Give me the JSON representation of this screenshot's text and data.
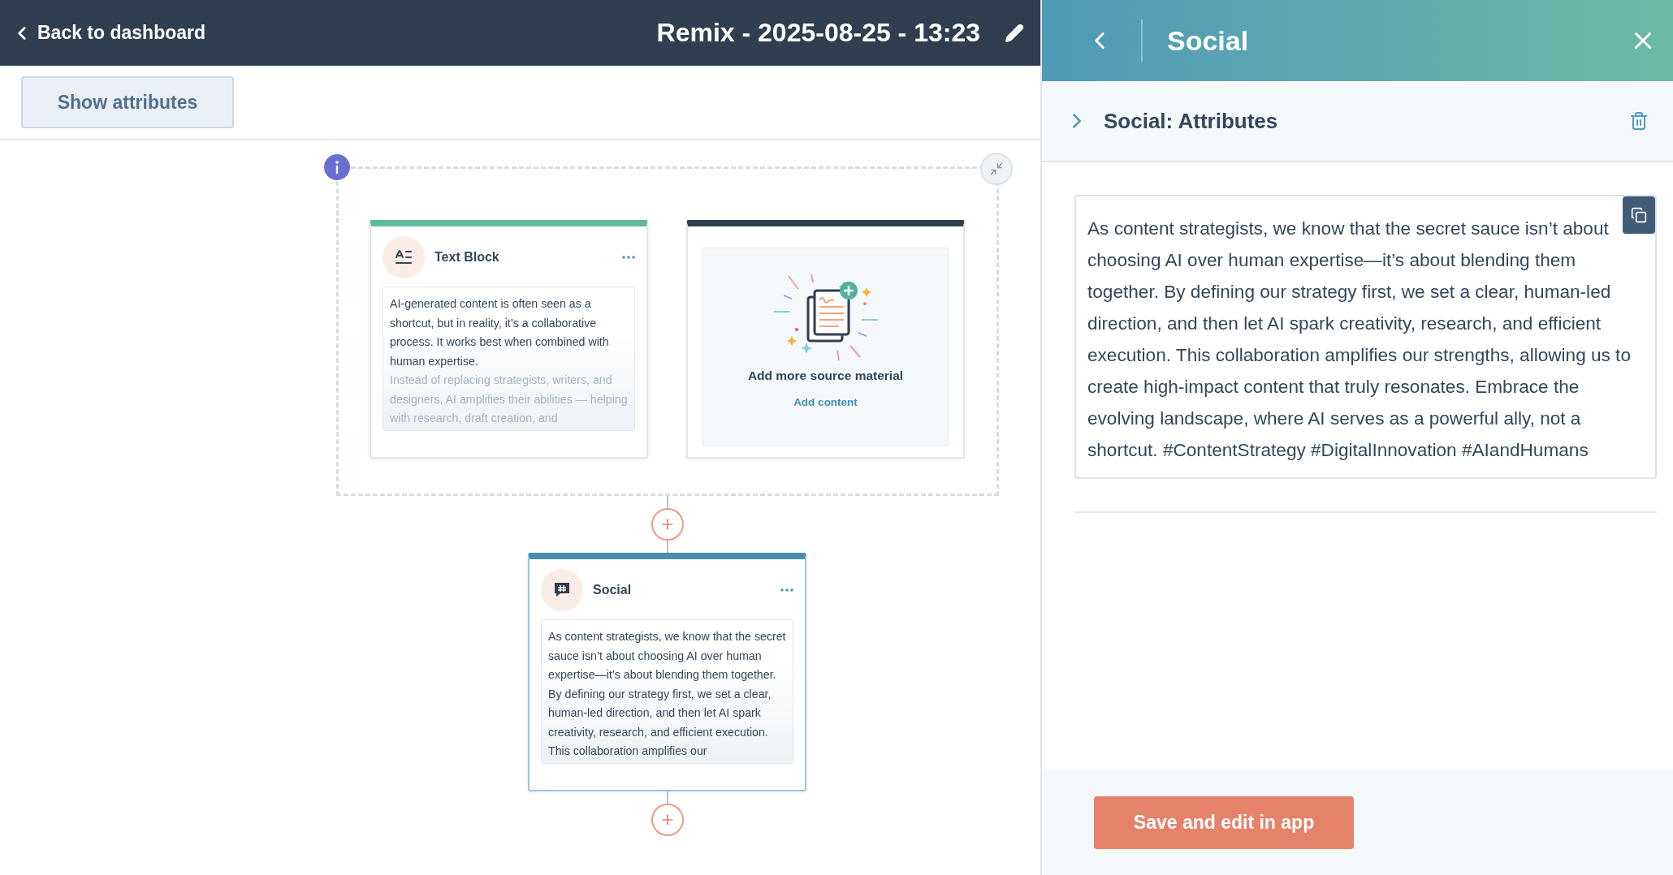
{
  "header": {
    "back_label": "Back to dashboard",
    "title": "Remix - 2025-08-25 - 13:23"
  },
  "toolbar": {
    "show_attributes": "Show attributes"
  },
  "canvas": {
    "group": {
      "cards": [
        {
          "kind": "text",
          "title": "Text Block",
          "paragraphs": [
            "AI-generated content is often seen as a shortcut, but in reality, it’s a collaborative process. It works best when combined with human expertise.",
            "Instead of replacing strategists, writers, and designers, AI amplifies their abilities — helping with research, draft creation, and"
          ]
        },
        {
          "kind": "source",
          "title": "Add more source material",
          "link": "Add content"
        }
      ]
    },
    "social_card": {
      "kind": "social",
      "title": "Social",
      "paragraphs": [
        "As content strategists, we know that the secret sauce isn’t about choosing AI over human expertise—it’s about blending them together. By defining our strategy first, we set a clear, human-led direction, and then let AI spark creativity, research, and efficient execution. This collaboration amplifies our"
      ]
    }
  },
  "panel": {
    "title": "Social",
    "section_title": "Social: Attributes",
    "section_expanded": false,
    "body": "As content strategists, we know that the secret sauce isn’t about choosing AI over human expertise—it’s about blending them together. By defining our strategy first, we set a clear, human-led direction, and then let AI spark creativity, research, and efficient execution. This collaboration amplifies our strengths, allowing us to create high-impact content that truly resonates. Embrace the evolving landscape, where AI serves as a powerful ally, not a shortcut. #ContentStrategy #DigitalInnovation #AIandHumans",
    "save_button": "Save and edit in app"
  }
}
